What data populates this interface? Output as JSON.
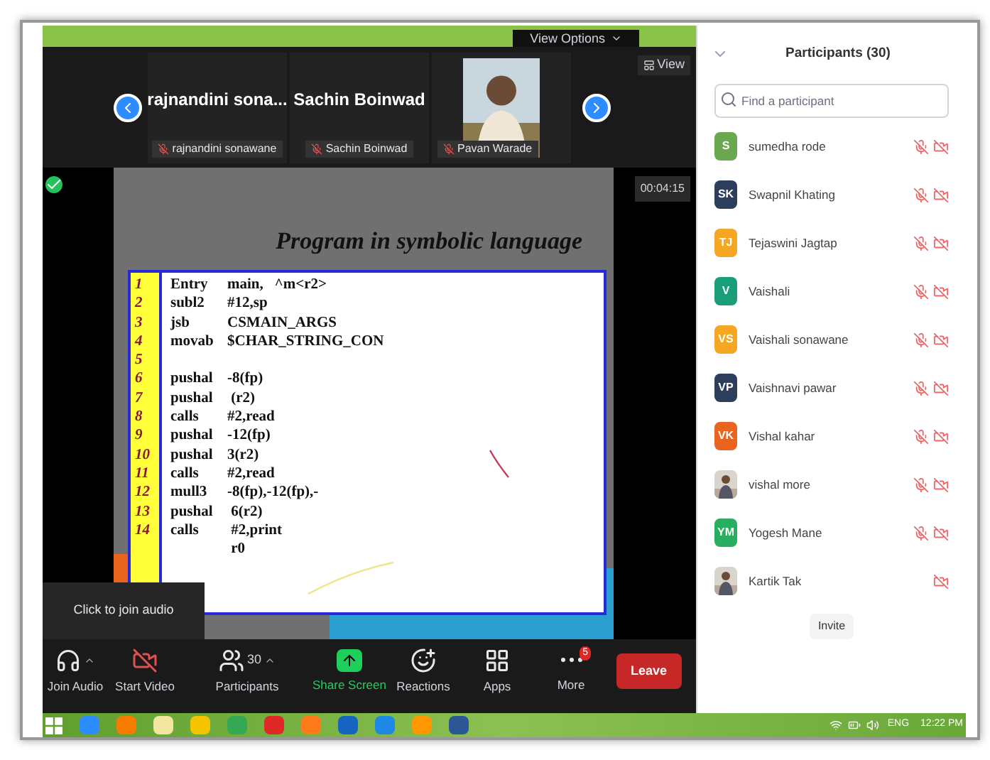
{
  "banner": {
    "button": "View Options"
  },
  "video_strip": {
    "view_button": "View",
    "tiles": [
      {
        "kind": "name",
        "name": "rajnandini sona...",
        "label": "rajnandini sonawane"
      },
      {
        "kind": "name",
        "name": "Sachin Boinwad",
        "label": "Sachin Boinwad"
      },
      {
        "kind": "picture",
        "label": "Pavan Warade"
      }
    ]
  },
  "timer": "00:04:15",
  "slide": {
    "title": "Program in symbolic language",
    "lines": [
      {
        "number": "1",
        "op": "Entry",
        "arg": "main,   ^m<r2>"
      },
      {
        "number": "2",
        "op": "subl2",
        "arg": "#12,sp"
      },
      {
        "number": "3",
        "op": "jsb",
        "arg": "CSMAIN_ARGS"
      },
      {
        "number": "4",
        "op": "movab",
        "arg": "$CHAR_STRING_CON"
      },
      {
        "number": "5"
      },
      {
        "number": "6",
        "op": "pushal",
        "arg": "-8(fp)"
      },
      {
        "number": "7",
        "op": "pushal",
        "arg": " (r2)"
      },
      {
        "number": "8",
        "op": "calls",
        "arg": "#2,read"
      },
      {
        "number": "9",
        "op": "pushal",
        "arg": "-12(fp)"
      },
      {
        "number": "10",
        "op": "pushal",
        "arg": "3(r2)"
      },
      {
        "number": "11",
        "op": "calls",
        "arg": "#2,read"
      },
      {
        "number": "12",
        "op": "mull3",
        "arg": "-8(fp),-12(fp),-"
      },
      {
        "number": "13",
        "op": "pushal",
        "arg": " 6(r2)"
      },
      {
        "number": "14",
        "op": "calls",
        "arg": " #2,print"
      },
      {
        "arg": " r0"
      }
    ]
  },
  "tooltip": "Click to join audio",
  "toolbar": [
    {
      "kind": "audio",
      "label": "Join Audio"
    },
    {
      "kind": "video",
      "label": "Start Video"
    },
    {
      "kind": "participants",
      "label": "Participants",
      "count": "30"
    },
    {
      "kind": "share",
      "label": "Share Screen"
    },
    {
      "kind": "reactions",
      "label": "Reactions"
    },
    {
      "kind": "apps",
      "label": "Apps"
    },
    {
      "kind": "more",
      "label": "More",
      "badge": "5"
    }
  ],
  "leave_button": "Leave",
  "participants": {
    "title": "Participants (30)",
    "search": {
      "placeholder": "Find a participant"
    },
    "items": [
      {
        "initials": "S",
        "color": "#6aa84f",
        "name": "sumedha rode",
        "mic_muted": true,
        "video_off": true
      },
      {
        "initials": "SK",
        "color": "#2d3e5c",
        "name": "Swapnil Khating",
        "mic_muted": true,
        "video_off": true
      },
      {
        "initials": "TJ",
        "color": "#f5a623",
        "name": "Tejaswini Jagtap",
        "mic_muted": true,
        "video_off": true
      },
      {
        "initials": "V",
        "color": "#1a9e7a",
        "name": "Vaishali",
        "mic_muted": true,
        "video_off": true
      },
      {
        "initials": "VS",
        "color": "#f5a623",
        "name": "Vaishali sonawane",
        "mic_muted": true,
        "video_off": true
      },
      {
        "initials": "VP",
        "color": "#2d3e5c",
        "name": "Vaishnavi pawar",
        "mic_muted": true,
        "video_off": true
      },
      {
        "initials": "VK",
        "color": "#e8641f",
        "name": "Vishal kahar",
        "mic_muted": true,
        "video_off": true
      },
      {
        "kind": "picture",
        "name": "vishal more",
        "mic_muted": true,
        "video_off": true
      },
      {
        "initials": "YM",
        "color": "#27ae60",
        "name": "Yogesh Mane",
        "mic_muted": true,
        "video_off": true
      },
      {
        "kind": "picture",
        "name": "Kartik Tak",
        "mic_muted": false,
        "video_off": true
      }
    ],
    "invite_button": "Invite"
  },
  "taskbar": {
    "language": "ENG",
    "time": "12:22 PM"
  }
}
